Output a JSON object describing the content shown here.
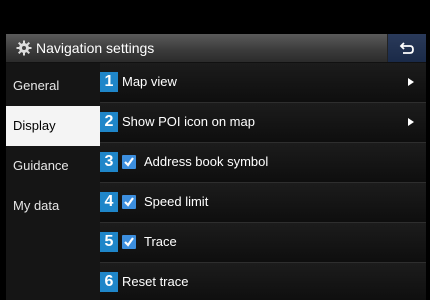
{
  "header": {
    "title": "Navigation settings",
    "icon": "gear-icon",
    "back_icon": "back-arrow-icon"
  },
  "sidebar": {
    "items": [
      {
        "label": "General",
        "active": false
      },
      {
        "label": "Display",
        "active": true
      },
      {
        "label": "Guidance",
        "active": false
      },
      {
        "label": "My data",
        "active": false
      }
    ]
  },
  "settings": {
    "rows": [
      {
        "number": "1",
        "label": "Map view",
        "type": "submenu"
      },
      {
        "number": "2",
        "label": "Show POI icon on map",
        "type": "submenu"
      },
      {
        "number": "3",
        "label": "Address book symbol",
        "type": "checkbox",
        "checked": true
      },
      {
        "number": "4",
        "label": "Speed limit",
        "type": "checkbox",
        "checked": true
      },
      {
        "number": "5",
        "label": "Trace",
        "type": "checkbox",
        "checked": true
      },
      {
        "number": "6",
        "label": "Reset trace",
        "type": "action"
      }
    ]
  },
  "colors": {
    "badge": "#1f86c9",
    "checkbox": "#3c8ede",
    "active_tab": "#f4f4f4"
  }
}
